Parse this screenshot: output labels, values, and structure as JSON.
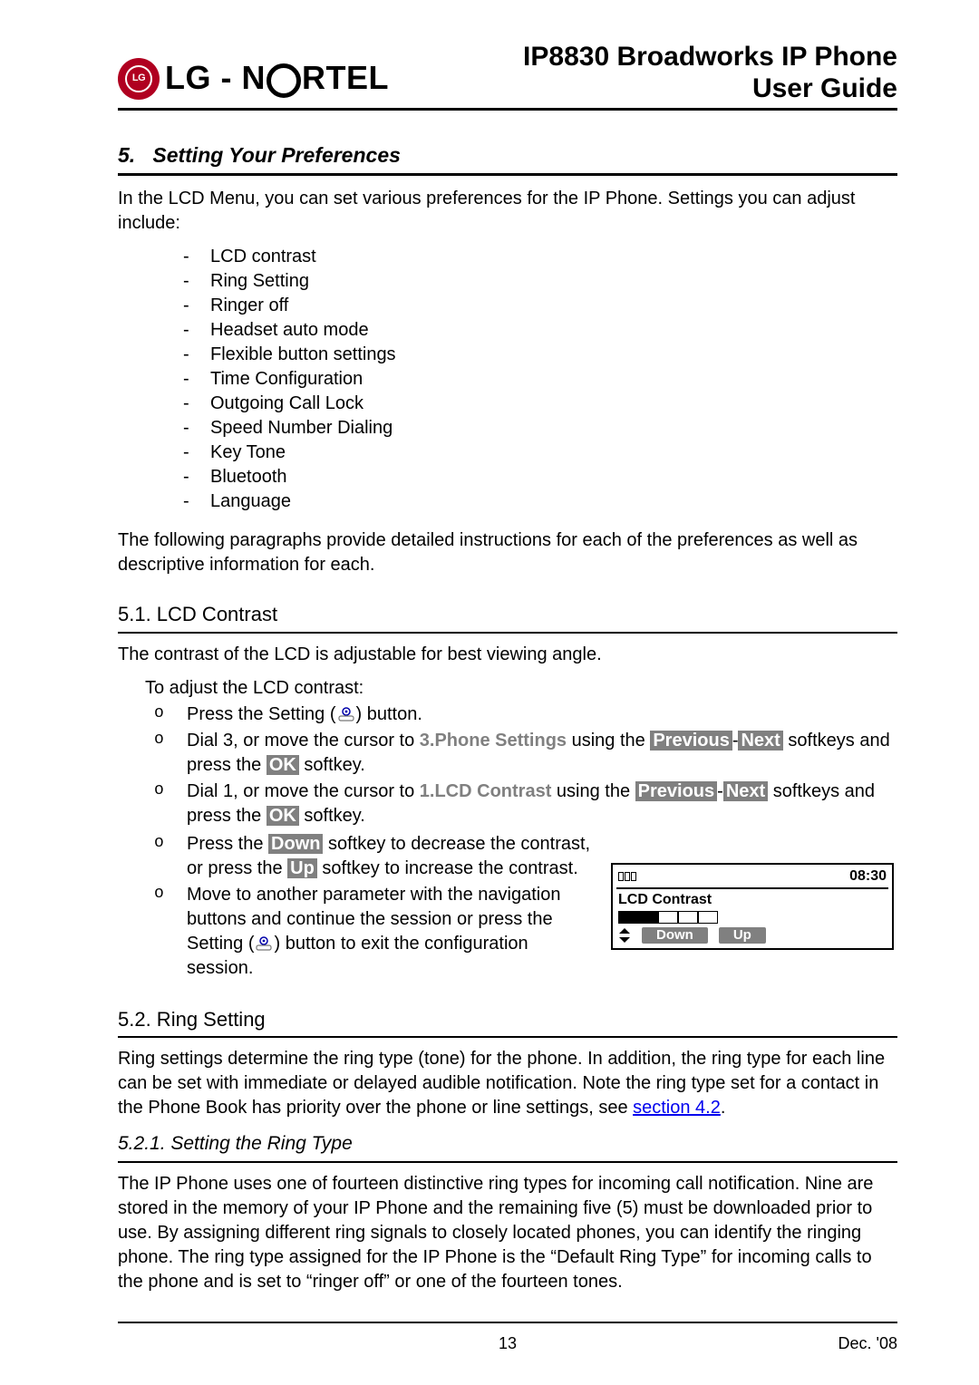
{
  "header": {
    "brand_prefix": "LG - N",
    "brand_suffix": "RTEL",
    "title_line1": "IP8830 Broadworks IP Phone",
    "title_line2": "User Guide"
  },
  "section": {
    "number": "5.",
    "title": "Setting Your Preferences",
    "intro": "In the LCD Menu, you can set various preferences for the IP Phone.  Settings you can adjust include:",
    "items": [
      "LCD contrast",
      "Ring Setting",
      "Ringer off",
      "Headset auto mode",
      "Flexible button settings",
      "Time Configuration",
      "Outgoing Call Lock",
      "Speed Number Dialing",
      "Key Tone",
      "Bluetooth",
      "Language"
    ],
    "closing": "The following paragraphs provide detailed instructions for each of the preferences as well as descriptive information for each."
  },
  "s51": {
    "heading": "5.1.   LCD Contrast",
    "intro": "The contrast of the LCD is adjustable for best viewing angle.",
    "lead": "To adjust the LCD contrast:",
    "b1a": "Press the Setting (",
    "b1b": ") button.",
    "b2a": "Dial 3, or move the cursor to ",
    "b2_menu": "3.Phone Settings",
    "b2b": " using the ",
    "prev": "Previous",
    "dash": "-",
    "next": "Next",
    "b2c": " softkeys and press the ",
    "ok": "OK",
    "b2d": " softkey.",
    "b3a": "Dial 1, or move the cursor to ",
    "b3_menu": "1.LCD Contrast",
    "b3b": " using the ",
    "b3c": " softkeys and press the ",
    "b3d": " softkey.",
    "b4a": "Press the ",
    "down": "Down",
    "b4b": " softkey to decrease the contrast, or press the ",
    "up": "Up",
    "b4c": " softkey to increase the contrast.",
    "b5a": "Move to another parameter with the navigation buttons and continue the session or press the Setting (",
    "b5b": ") button to exit the configuration session."
  },
  "lcd": {
    "time": "08:30",
    "title": "LCD Contrast",
    "btn_down": "Down",
    "btn_up": "Up"
  },
  "s52": {
    "heading": "5.2.   Ring Setting",
    "p1a": "Ring settings determine the ring type (tone) for the phone.  In addition, the ring type for each line can be set with immediate or delayed audible notification.  Note the ring type set for a contact in the Phone Book has priority over the phone or line settings, see ",
    "link": "section 4.2",
    "p1b": ".",
    "sub": "5.2.1.  Setting the Ring Type",
    "p2": "The IP Phone uses one of fourteen distinctive ring types for incoming call notification.  Nine are stored in the memory of your IP Phone and the remaining five (5) must be downloaded prior to use.  By assigning different ring signals to closely located phones, you can identify the ringing phone.  The ring type assigned for the IP Phone is the “Default Ring Type” for incoming calls to the phone and is set to “ringer off” or one of the fourteen tones."
  },
  "footer": {
    "page": "13",
    "date": "Dec. '08"
  }
}
